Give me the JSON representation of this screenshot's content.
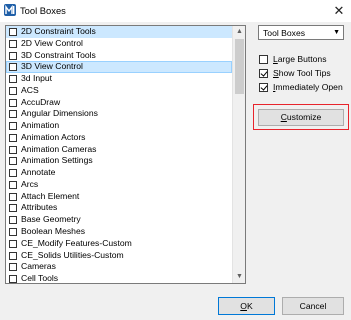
{
  "window": {
    "title": "Tool Boxes",
    "close_glyph": "✕",
    "app_icon": "microstation-logo-icon"
  },
  "tools_list": {
    "items": [
      {
        "label": "2D Constraint Tools",
        "checked": false,
        "state": "highlighted"
      },
      {
        "label": "2D View Control",
        "checked": false,
        "state": ""
      },
      {
        "label": "3D Constraint Tools",
        "checked": false,
        "state": ""
      },
      {
        "label": "3D View Control",
        "checked": false,
        "state": "selected"
      },
      {
        "label": "3d Input",
        "checked": false,
        "state": ""
      },
      {
        "label": "ACS",
        "checked": false,
        "state": ""
      },
      {
        "label": "AccuDraw",
        "checked": false,
        "state": ""
      },
      {
        "label": "Angular Dimensions",
        "checked": false,
        "state": ""
      },
      {
        "label": "Animation",
        "checked": false,
        "state": ""
      },
      {
        "label": "Animation Actors",
        "checked": false,
        "state": ""
      },
      {
        "label": "Animation Cameras",
        "checked": false,
        "state": ""
      },
      {
        "label": "Animation Settings",
        "checked": false,
        "state": ""
      },
      {
        "label": "Annotate",
        "checked": false,
        "state": ""
      },
      {
        "label": "Arcs",
        "checked": false,
        "state": ""
      },
      {
        "label": "Attach Element",
        "checked": false,
        "state": ""
      },
      {
        "label": "Attributes",
        "checked": false,
        "state": ""
      },
      {
        "label": "Base Geometry",
        "checked": false,
        "state": ""
      },
      {
        "label": "Boolean Meshes",
        "checked": false,
        "state": ""
      },
      {
        "label": "CE_Modify Features-Custom",
        "checked": false,
        "state": ""
      },
      {
        "label": "CE_Solids Utilities-Custom",
        "checked": false,
        "state": ""
      },
      {
        "label": "Cameras",
        "checked": false,
        "state": ""
      },
      {
        "label": "Cell Tools",
        "checked": false,
        "state": ""
      }
    ],
    "scroll_up_glyph": "▲",
    "scroll_down_glyph": "▼"
  },
  "view_select": {
    "value": "Tool Boxes",
    "arrow_glyph": "▼"
  },
  "options": {
    "large_buttons": {
      "prefix": "",
      "accel": "L",
      "rest": "arge Buttons",
      "checked": false
    },
    "show_tool_tips": {
      "prefix": "",
      "accel": "S",
      "rest": "how Tool Tips",
      "checked": true
    },
    "immediately_open": {
      "prefix": "",
      "accel": "I",
      "rest": "mmediately Open",
      "checked": true
    }
  },
  "buttons": {
    "customize": {
      "prefix": "",
      "accel": "C",
      "rest": "ustomize"
    },
    "ok": {
      "prefix": "",
      "accel": "O",
      "rest": "K"
    },
    "cancel": {
      "label": "Cancel"
    }
  },
  "colors": {
    "highlight_row": "#cce8ff",
    "callout_border": "#e8242c",
    "default_button_border": "#0078d7"
  }
}
